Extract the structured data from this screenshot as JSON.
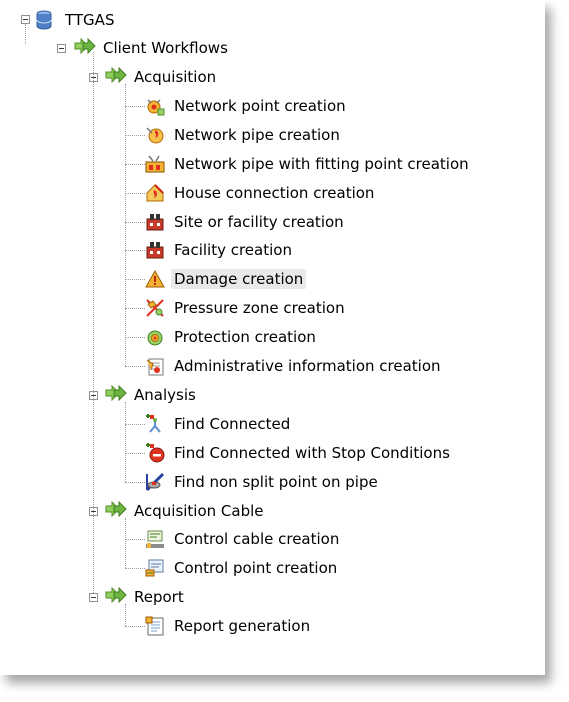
{
  "tree": {
    "root": {
      "label": "TTGAS",
      "icon": "database-icon"
    },
    "client_workflows": {
      "label": "Client Workflows",
      "icon": "workflow-arrows-icon"
    },
    "groups": [
      {
        "label": "Acquisition",
        "icon": "workflow-arrows-icon",
        "items": [
          {
            "label": "Network point creation",
            "icon": "network-point-icon"
          },
          {
            "label": "Network pipe creation",
            "icon": "network-pipe-icon"
          },
          {
            "label": "Network pipe with fitting point creation",
            "icon": "pipe-fitting-icon"
          },
          {
            "label": "House connection creation",
            "icon": "house-connection-icon"
          },
          {
            "label": "Site or facility creation",
            "icon": "site-facility-icon"
          },
          {
            "label": "Facility creation",
            "icon": "facility-icon"
          },
          {
            "label": "Damage creation",
            "icon": "damage-warning-icon",
            "selected": true
          },
          {
            "label": "Pressure zone creation",
            "icon": "pressure-zone-icon"
          },
          {
            "label": "Protection creation",
            "icon": "protection-icon"
          },
          {
            "label": "Administrative information creation",
            "icon": "admin-info-icon"
          }
        ]
      },
      {
        "label": "Analysis",
        "icon": "workflow-arrows-icon",
        "items": [
          {
            "label": "Find Connected",
            "icon": "find-connected-icon"
          },
          {
            "label": "Find Connected with Stop Conditions",
            "icon": "find-connected-stop-icon"
          },
          {
            "label": "Find non split point on pipe",
            "icon": "find-split-point-icon"
          }
        ]
      },
      {
        "label": "Acquisition Cable",
        "icon": "workflow-arrows-icon",
        "items": [
          {
            "label": "Control cable creation",
            "icon": "control-cable-icon"
          },
          {
            "label": "Control point creation",
            "icon": "control-point-icon"
          }
        ]
      },
      {
        "label": "Report",
        "icon": "workflow-arrows-icon",
        "items": [
          {
            "label": "Report generation",
            "icon": "report-icon"
          }
        ]
      }
    ]
  },
  "colors": {
    "arrow_green": "#6db33f",
    "database_blue": "#3f6fb5",
    "selection_bg": "#e9e9e9"
  }
}
